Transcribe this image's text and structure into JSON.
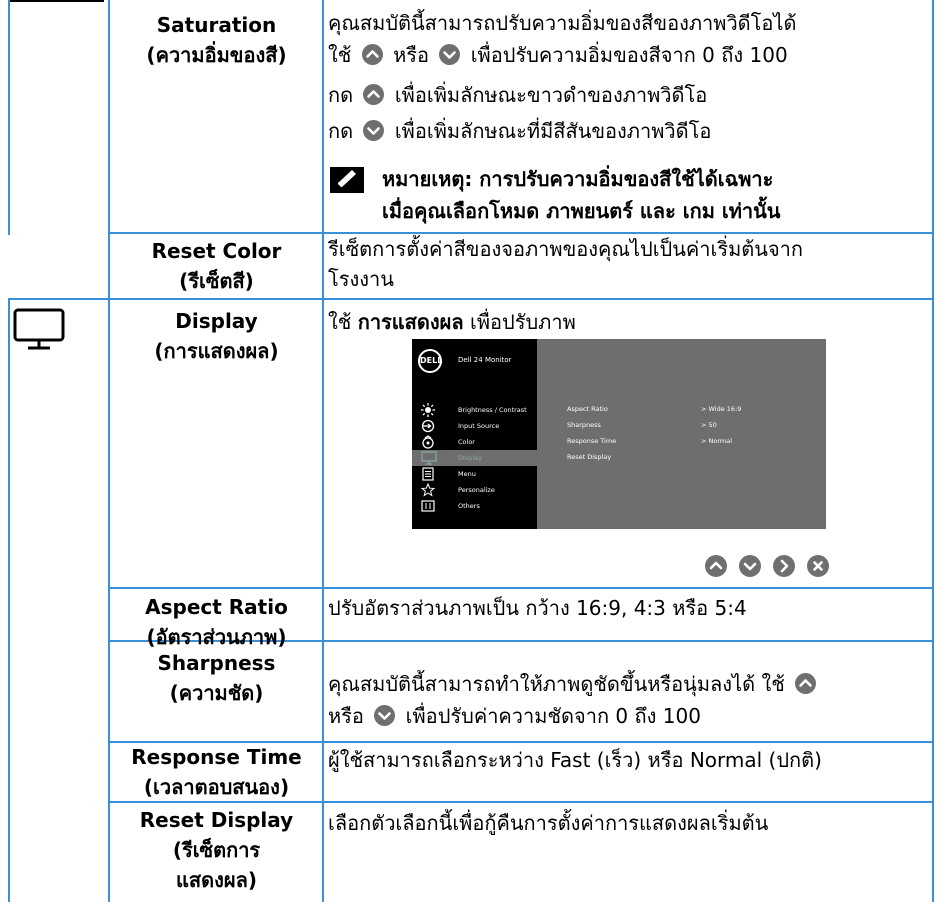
{
  "rows": [
    {
      "name_en": "Saturation",
      "name_th": "(ความอิ่มของสี)",
      "desc_lines": [
        "คุณสมบัตินี้สามารถปรับความอิ่มของสีของภาพวิดีโอได้",
        [
          "ใช้",
          "หรือ",
          "เพื่อปรับความอิ่มของสีจาก 0 ถึง 100"
        ],
        [
          "กด",
          "เพื่อเพิ่มลักษณะขาวดำของภาพวิดีโอ"
        ],
        [
          "กด",
          "เพื่อเพิ่มลักษณะที่มีสีสันของภาพวิดีโอ"
        ]
      ],
      "note_line1": "หมายเหตุ: การปรับความอิ่มของสีใช้ได้เฉพาะ",
      "note_line2": "เมื่อคุณเลือกโหมด ภาพยนตร์ และ เกม เท่านั้น"
    },
    {
      "name_en": "Reset Color",
      "name_th": "(รีเซ็ตสี)",
      "desc_line1": "รีเซ็ตการตั้งค่าสีของจอภาพของคุณไปเป็นค่าเริ่มต้นจาก",
      "desc_line2": "โรงงาน"
    },
    {
      "name_en": "Display",
      "name_th": "(การแสดงผล)",
      "desc_prefix": "ใช้",
      "desc_bold": "การแสดงผล",
      "desc_suffix": "เพื่อปรับภาพ"
    },
    {
      "name_en": "Aspect Ratio",
      "name_th": "(อัตราส่วนภาพ)",
      "desc": "ปรับอัตราส่วนภาพเป็น กว้าง 16:9, 4:3 หรือ 5:4"
    },
    {
      "name_en": "Sharpness",
      "name_th": "(ความชัด)",
      "desc_line1": "คุณสมบัตินี้สามารถทำให้ภาพดูชัดขึ้นหรือนุ่มลงได้ ใช้",
      "desc_line2_a": "หรือ",
      "desc_line2_b": "เพื่อปรับค่าความชัดจาก 0 ถึง 100"
    },
    {
      "name_en": "Response Time",
      "name_th": "(เวลาตอบสนอง)",
      "desc": "ผู้ใช้สามารถเลือกระหว่าง Fast (เร็ว) หรือ Normal (ปกติ)"
    },
    {
      "name_en": "Reset Display",
      "name_th1": "(รีเซ็ตการ",
      "name_th2": "แสดงผล)",
      "desc": "เลือกตัวเลือกนี้เพื่อกู้คืนการตั้งค่าการแสดงผลเริ่มต้น"
    }
  ],
  "osd": {
    "logo": "DELL",
    "title": "Dell 24 Monitor",
    "menu": [
      {
        "label": "Brightness / Contrast",
        "icon": "brightness-icon"
      },
      {
        "label": "Input Source",
        "icon": "input-source-icon"
      },
      {
        "label": "Color",
        "icon": "color-icon"
      },
      {
        "label": "Display",
        "icon": "display-icon"
      },
      {
        "label": "Menu",
        "icon": "menu-icon"
      },
      {
        "label": "Personalize",
        "icon": "star-icon"
      },
      {
        "label": "Others",
        "icon": "others-icon"
      }
    ],
    "settings": [
      {
        "label": "Aspect Ratio",
        "value": "> Wide 16:9"
      },
      {
        "label": "Sharpness",
        "value": "> 50"
      },
      {
        "label": "Response Time",
        "value": "> Normal"
      },
      {
        "label": "Reset Display",
        "value": ""
      }
    ]
  },
  "colors": {
    "border": "#3a8fd6",
    "button": "#6f6f6f",
    "osd_panel": "#6e6e6e"
  }
}
